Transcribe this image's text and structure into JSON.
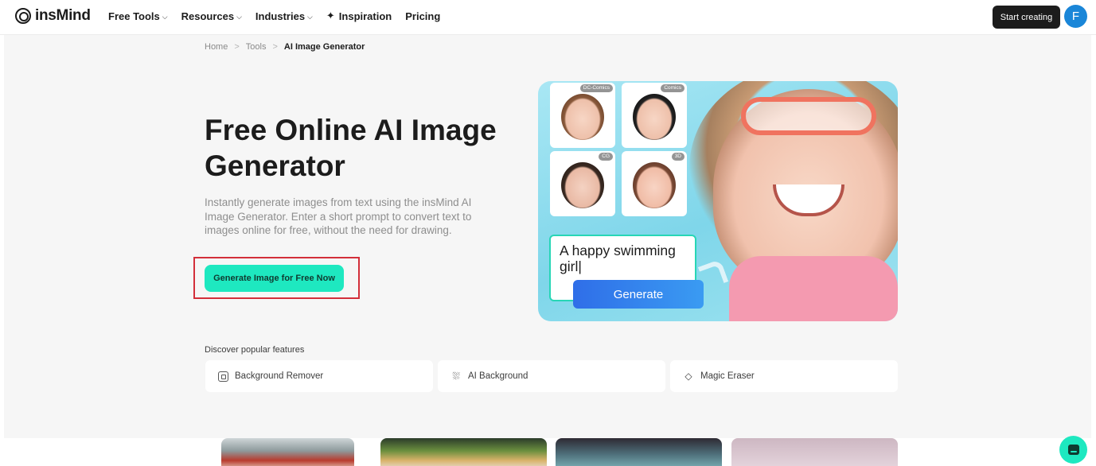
{
  "nav": {
    "logo_text": "insMind",
    "menu": [
      {
        "label": "Free Tools",
        "dropdown": true
      },
      {
        "label": "Resources",
        "dropdown": true
      },
      {
        "label": "Industries",
        "dropdown": true
      },
      {
        "label": "Inspiration",
        "dropdown": false
      },
      {
        "label": "Pricing",
        "dropdown": false
      }
    ],
    "start_button": "Start creating",
    "avatar_initial": "F"
  },
  "breadcrumb": {
    "items": [
      "Home",
      "Tools",
      "AI Image Generator"
    ],
    "separator": ">"
  },
  "hero": {
    "title": "Free Online AI Image Generator",
    "description": "Instantly generate images from text using the insMind AI Image Generator. Enter a short prompt to convert text to images online for free, without the need for drawing.",
    "cta_label": "Generate Image for Free Now"
  },
  "illustration": {
    "thumb_badges": [
      "DC-Comics",
      "Comics",
      "CG",
      "3D"
    ],
    "prompt_text": "A happy swimming girl|",
    "generate_label": "Generate"
  },
  "features": {
    "label": "Discover popular features",
    "items": [
      {
        "label": "Background Remover",
        "icon": "background-remover-icon"
      },
      {
        "label": "AI Background",
        "icon": "ai-background-icon"
      },
      {
        "label": "Magic Eraser",
        "icon": "magic-eraser-icon"
      }
    ]
  },
  "colors": {
    "accent": "#1ee8c0",
    "highlight_outline": "#d32f3a",
    "avatar": "#1a86d8",
    "generate_button": "#2f6ee8"
  }
}
